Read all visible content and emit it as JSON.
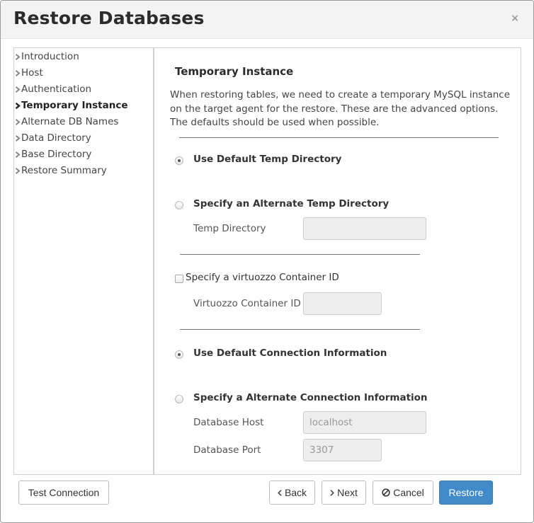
{
  "dialog": {
    "title": "Restore Databases",
    "close_glyph": "×",
    "close_icon": "close-icon"
  },
  "sidebar": {
    "items": [
      {
        "label": "Introduction",
        "active": false
      },
      {
        "label": "Host",
        "active": false
      },
      {
        "label": "Authentication",
        "active": false
      },
      {
        "label": "Temporary Instance",
        "active": true
      },
      {
        "label": "Alternate DB Names",
        "active": false
      },
      {
        "label": "Data Directory",
        "active": false
      },
      {
        "label": "Base Directory",
        "active": false
      },
      {
        "label": "Restore Summary",
        "active": false
      }
    ],
    "item_icon": "chevron-right-icon"
  },
  "panel": {
    "heading": "Temporary Instance",
    "description": "When restoring tables, we need to create a temporary MySQL instance on the target agent for the restore. These are the advanced options. The defaults should be used when possible.",
    "temp_dir": {
      "default_label": "Use Default Temp Directory",
      "default_checked": true,
      "alternate_label": "Specify an Alternate Temp Directory",
      "alternate_checked": false,
      "field_label": "Temp Directory",
      "field_value": ""
    },
    "container": {
      "checkbox_label": "Specify a virtuozzo Container ID",
      "checked": false,
      "field_label": "Virtuozzo Container ID",
      "field_value": ""
    },
    "connection": {
      "default_label": "Use Default Connection Information",
      "default_checked": true,
      "alternate_label": "Specify a Alternate Connection Information",
      "alternate_checked": false,
      "host_label": "Database Host",
      "host_value": "localhost",
      "port_label": "Database Port",
      "port_value": "3307"
    }
  },
  "footer": {
    "test_connection": "Test Connection",
    "back": "Back",
    "back_icon": "chevron-left-icon",
    "next": "Next",
    "next_icon": "chevron-right-icon",
    "cancel": "Cancel",
    "cancel_icon": "ban-icon",
    "restore": "Restore"
  },
  "colors": {
    "primary": "#428bca",
    "title_bar": "#f3f3f3",
    "input_disabled_bg": "#eeeeee"
  }
}
